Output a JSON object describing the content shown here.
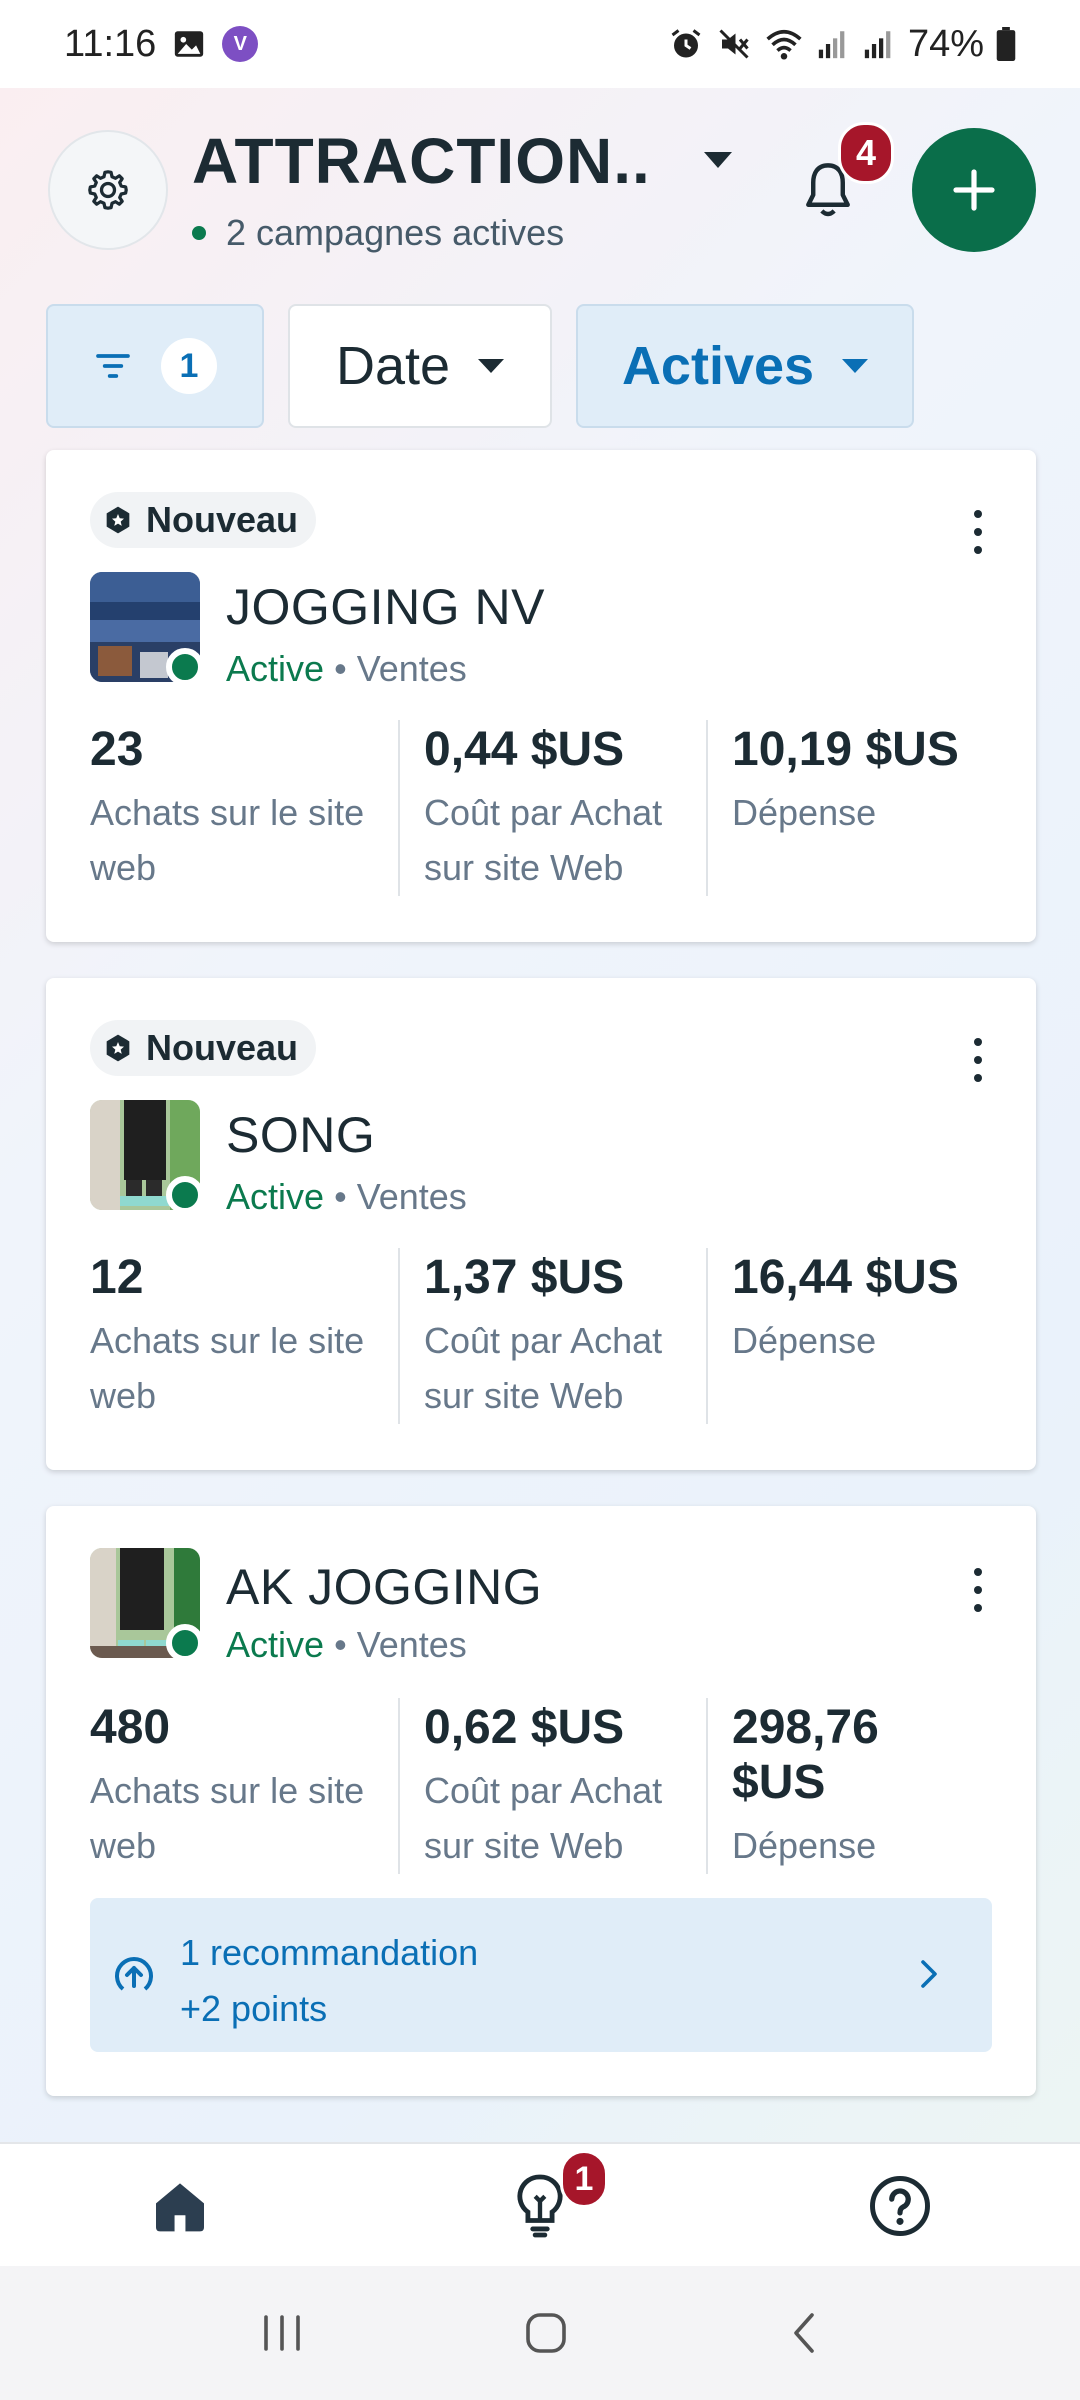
{
  "status_bar": {
    "time": "11:16",
    "battery": "74%"
  },
  "header": {
    "account_name": "ATTRACTION..",
    "campaign_count": "2 campagnes actives",
    "notification_count": "4"
  },
  "filters": {
    "filter_count": "1",
    "date_label": "Date",
    "status_label": "Actives"
  },
  "campaigns": [
    {
      "badge": "Nouveau",
      "name": "JOGGING NV",
      "status": "Active",
      "separator": "•",
      "objective": "Ventes",
      "metrics": [
        {
          "value": "23",
          "label": "Achats sur le site web"
        },
        {
          "value": "0,44 $US",
          "label": "Coût par Achat sur site Web"
        },
        {
          "value": "10,19 $US",
          "label": "Dépense"
        }
      ]
    },
    {
      "badge": "Nouveau",
      "name": "SONG",
      "status": "Active",
      "separator": "•",
      "objective": "Ventes",
      "metrics": [
        {
          "value": "12",
          "label": "Achats sur le site web"
        },
        {
          "value": "1,37 $US",
          "label": "Coût par Achat sur site Web"
        },
        {
          "value": "16,44 $US",
          "label": "Dépense"
        }
      ]
    },
    {
      "badge": "",
      "name": "AK JOGGING",
      "status": "Active",
      "separator": "•",
      "objective": "Ventes",
      "metrics": [
        {
          "value": "480",
          "label": "Achats sur le site web"
        },
        {
          "value": "0,62 $US",
          "label": "Coût par Achat sur site Web"
        },
        {
          "value": "298,76 $US",
          "label": "Dépense"
        }
      ],
      "recommendation": {
        "title": "1 recommandation",
        "points": "+2 points"
      }
    }
  ],
  "bottom_nav": {
    "ideas_badge": "1",
    "items": [
      "home-icon",
      "lightbulb-icon",
      "help-icon"
    ]
  },
  "colors": {
    "brand_green": "#0a6e4a",
    "active_green": "#0b7a4e",
    "link_blue": "#0a6fb5",
    "badge_red": "#a6162a",
    "chip_blue_bg": "#e0edf8"
  }
}
